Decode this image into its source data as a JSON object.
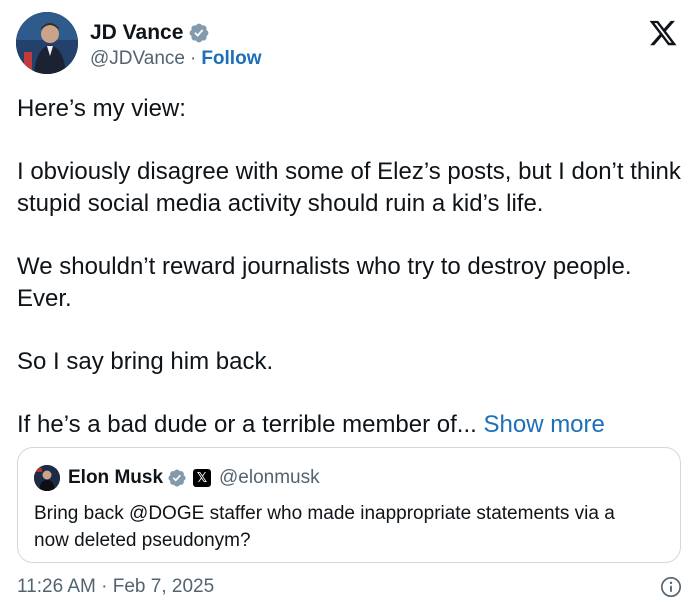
{
  "author": {
    "name": "JD Vance",
    "handle": "@JDVance",
    "separator": "·",
    "follow_label": "Follow"
  },
  "tweet": {
    "paragraphs": [
      "Here’s my view:",
      "I obviously disagree with some of Elez’s posts, but I don’t think stupid social media activity should ruin a kid’s life.",
      "We shouldn’t reward journalists who try to destroy people. Ever.",
      "So I say bring him back."
    ],
    "last_line": "If he’s a bad dude or a terrible member of...",
    "show_more_label": "Show more"
  },
  "quote": {
    "name": "Elon Musk",
    "affiliation_badge": "𝕏",
    "handle": "@elonmusk",
    "text": "Bring back @DOGE staffer who made inappropriate statements via a now deleted pseudonym?"
  },
  "footer": {
    "timestamp": "11:26 AM · Feb 7, 2025"
  },
  "icons": {
    "x_logo": "x-logo-icon",
    "verified": "verified-badge-icon",
    "info": "info-icon"
  },
  "colors": {
    "accent": "#1d6fb8",
    "text": "#0f1419",
    "secondary": "#536471",
    "border": "#cfd9de",
    "verified": "#829aab"
  }
}
